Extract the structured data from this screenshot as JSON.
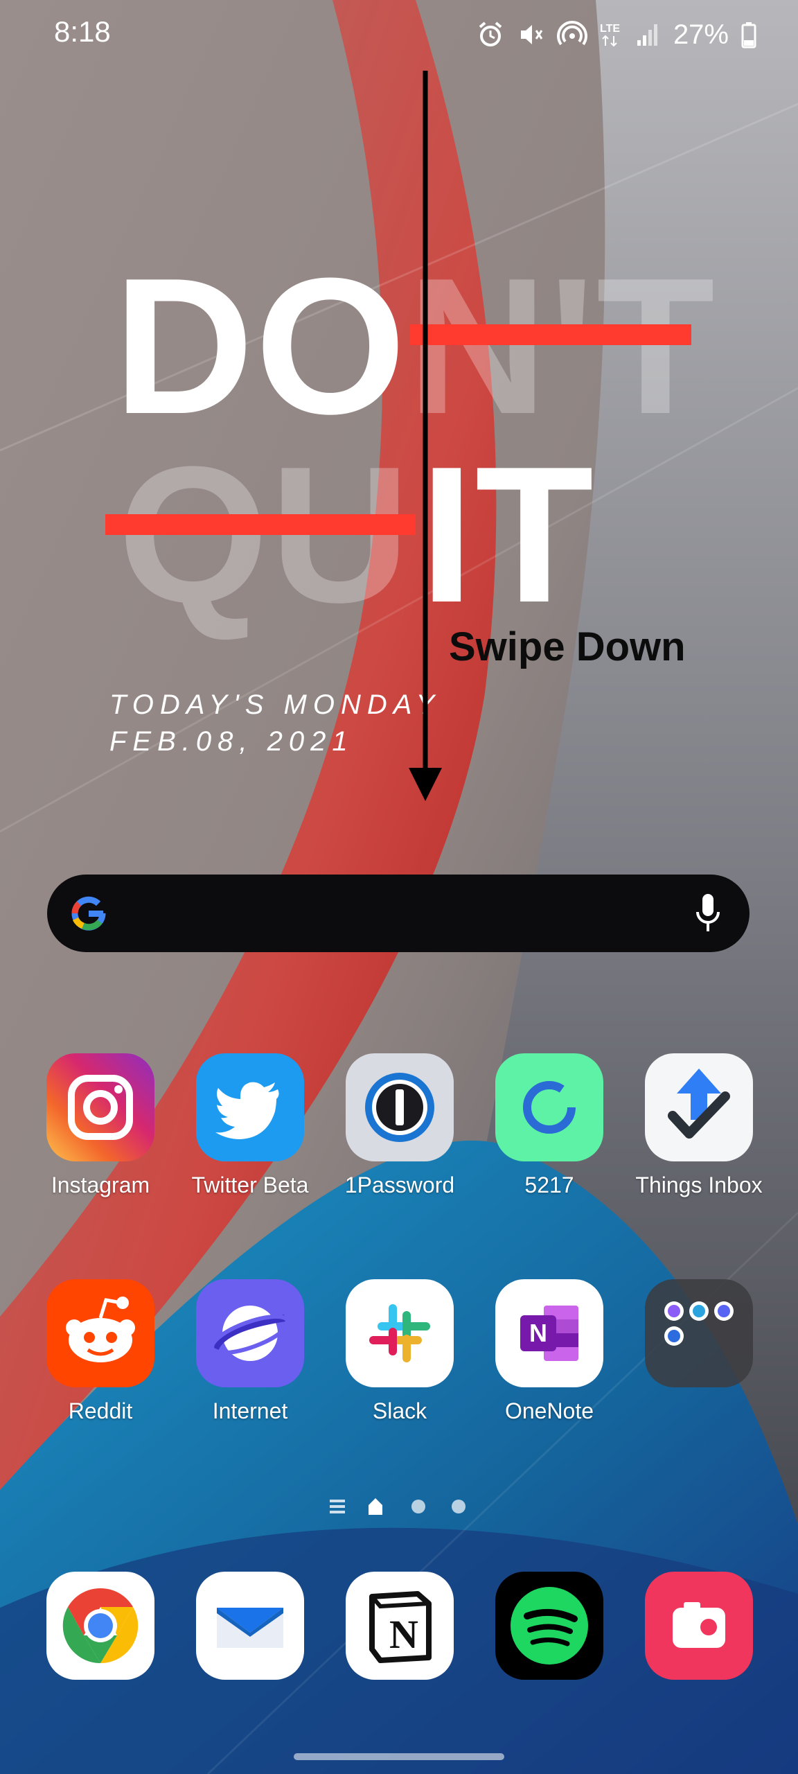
{
  "status_bar": {
    "time": "8:18",
    "network": "LTE",
    "battery": "27%",
    "icons": [
      "alarm-icon",
      "mute-icon",
      "hotspot-icon",
      "lte-icon",
      "signal-icon",
      "battery-icon"
    ]
  },
  "wallpaper": {
    "word_do": "DO",
    "word_nt": "N'T",
    "word_qu": "QU",
    "word_it": "IT",
    "swipe_hint": "Swipe Down",
    "date_line_1": "TODAY'S MONDAY",
    "date_line_2": "FEB.08, 2021",
    "colors": {
      "strike": "#ff3b30",
      "accent_red": "#d42f2f",
      "accent_blue": "#1780b8"
    }
  },
  "search_bar": {
    "provider_icon": "google-icon",
    "voice_icon": "mic-icon"
  },
  "apps_row_1": [
    {
      "label": "Instagram",
      "icon": "instagram-icon"
    },
    {
      "label": "Twitter Beta",
      "icon": "twitter-icon"
    },
    {
      "label": "1Password",
      "icon": "1password-icon"
    },
    {
      "label": "5217",
      "icon": "5217-icon"
    },
    {
      "label": "Things Inbox",
      "icon": "things-icon"
    }
  ],
  "apps_row_2": [
    {
      "label": "Reddit",
      "icon": "reddit-icon"
    },
    {
      "label": "Internet",
      "icon": "internet-icon"
    },
    {
      "label": "Slack",
      "icon": "slack-icon"
    },
    {
      "label": "OneNote",
      "icon": "onenote-icon"
    },
    {
      "label": "",
      "icon": "folder-icon"
    }
  ],
  "page_indicator": {
    "pages": 3,
    "current": "home"
  },
  "dock": [
    {
      "icon": "chrome-icon"
    },
    {
      "icon": "email-icon"
    },
    {
      "icon": "notion-icon"
    },
    {
      "icon": "spotify-icon"
    },
    {
      "icon": "camera-icon"
    }
  ]
}
